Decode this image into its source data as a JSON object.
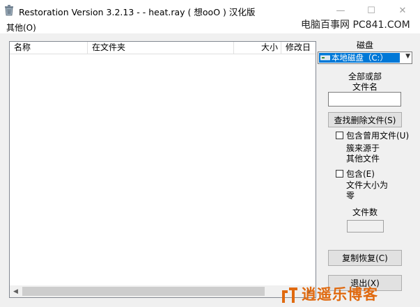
{
  "window": {
    "title": "Restoration Version 3.2.13   -  - heat.ray ( 想ooO ) 汉化版",
    "minimize_glyph": "—",
    "maximize_glyph": "☐",
    "close_glyph": "✕"
  },
  "menu": {
    "items": [
      {
        "label": "其他(O)"
      }
    ]
  },
  "watermark_top": "电脑百事网 PC841.COM",
  "list": {
    "columns": [
      "名称",
      "在文件夹",
      "大小",
      "修改日"
    ],
    "rows": []
  },
  "panel": {
    "drive_label": "磁盘",
    "drive_selected": "本地磁盘（C:）",
    "filename_label_line1": "全部或部",
    "filename_label_line2": "文件名",
    "filename_value": "",
    "search_button": "查找删除文件(S)",
    "include_used_label": "包含曾用文件(U)",
    "include_used_sub1": "簇来源于",
    "include_used_sub2": "其他文件",
    "include_used_checked": false,
    "include_zero_label": "包含(E)",
    "include_zero_sub1": "文件大小为",
    "include_zero_sub2": "零",
    "include_zero_checked": false,
    "file_count_label": "文件数",
    "file_count_value": "",
    "restore_button": "复制恢复(C)",
    "exit_button": "退出(X)"
  },
  "logo_text": "逍遥乐博客",
  "colors": {
    "selection": "#0078d7",
    "logo": "#e06a10"
  }
}
